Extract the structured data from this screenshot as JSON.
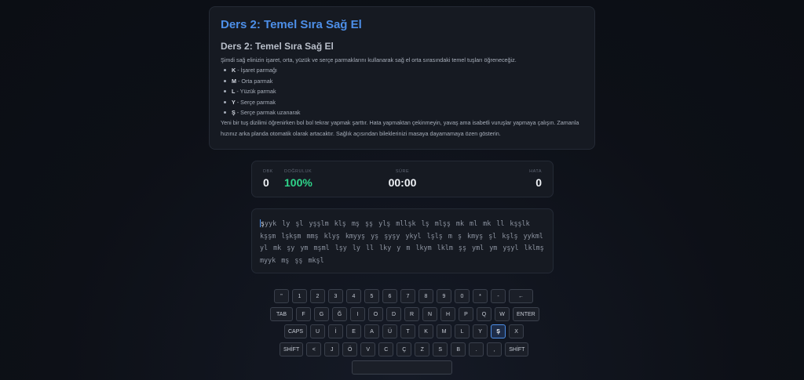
{
  "lesson": {
    "title": "Ders 2: Temel Sıra Sağ El",
    "subtitle": "Ders 2: Temel Sıra Sağ El",
    "intro": "Şimdi sağ elinizin işaret, orta, yüzük ve serçe parmaklarını kullanarak sağ el orta sırasındaki temel tuşları öğreneceğiz.",
    "fingers": [
      {
        "key": "K",
        "desc": "- İşaret parmağı"
      },
      {
        "key": "M",
        "desc": "- Orta parmak"
      },
      {
        "key": "L",
        "desc": "- Yüzük parmak"
      },
      {
        "key": "Y",
        "desc": "- Serçe parmak"
      },
      {
        "key": "Ş",
        "desc": "- Serçe parmak uzanarak"
      }
    ],
    "outro": "Yeni bir tuş dizilimi öğrenirken bol bol tekrar yapmak şarttır. Hata yapmaktan çekinmeyin, yavaş ama isabetli vuruşlar yapmaya çalışın. Zamanla hızınız arka planda otomatik olarak artacaktır. Sağlık açısından bileklerinizi masaya dayamamaya özen gösterin."
  },
  "stats": {
    "wpm_label": "DBK",
    "wpm_value": "0",
    "accuracy_label": "DOĞRULUK",
    "accuracy_value": "100%",
    "time_label": "SÜRE",
    "time_value": "00:00",
    "error_label": "HATA",
    "error_value": "0"
  },
  "practice": {
    "current_char": "ş",
    "remaining_text": "yyk ly şl yşşlm klş mş şş ylş mllşk lş mlşş mk ml mk ll kşşlk kşşm lşkşm mmş klyş kmyyş yş şyşy ykyl lşlş m ş kmyş şl kşlş yykml yl mk şy ym mşml lşy ly ll lky y m lkym lklm şş yml ym yşyl lklmş myyk mş şş mkşl"
  },
  "keyboard": {
    "active_key": "Ş",
    "rows": [
      [
        "\"",
        "1",
        "2",
        "3",
        "4",
        "5",
        "6",
        "7",
        "8",
        "9",
        "0",
        "*",
        "-",
        "←"
      ],
      [
        "TAB",
        "F",
        "G",
        "Ğ",
        "I",
        "O",
        "D",
        "R",
        "N",
        "H",
        "P",
        "Q",
        "W",
        "ENTER"
      ],
      [
        "CAPS",
        "U",
        "İ",
        "E",
        "A",
        "Ü",
        "T",
        "K",
        "M",
        "L",
        "Y",
        "Ş",
        "X"
      ],
      [
        "SHİFT",
        "<",
        "J",
        "Ö",
        "V",
        "C",
        "Ç",
        "Z",
        "S",
        "B",
        ".",
        ",",
        "SHİFT"
      ]
    ]
  },
  "colors": {
    "accent": "#4d8fe8",
    "success": "#2fd48a",
    "background": "#0d1017",
    "card": "#161a22"
  }
}
